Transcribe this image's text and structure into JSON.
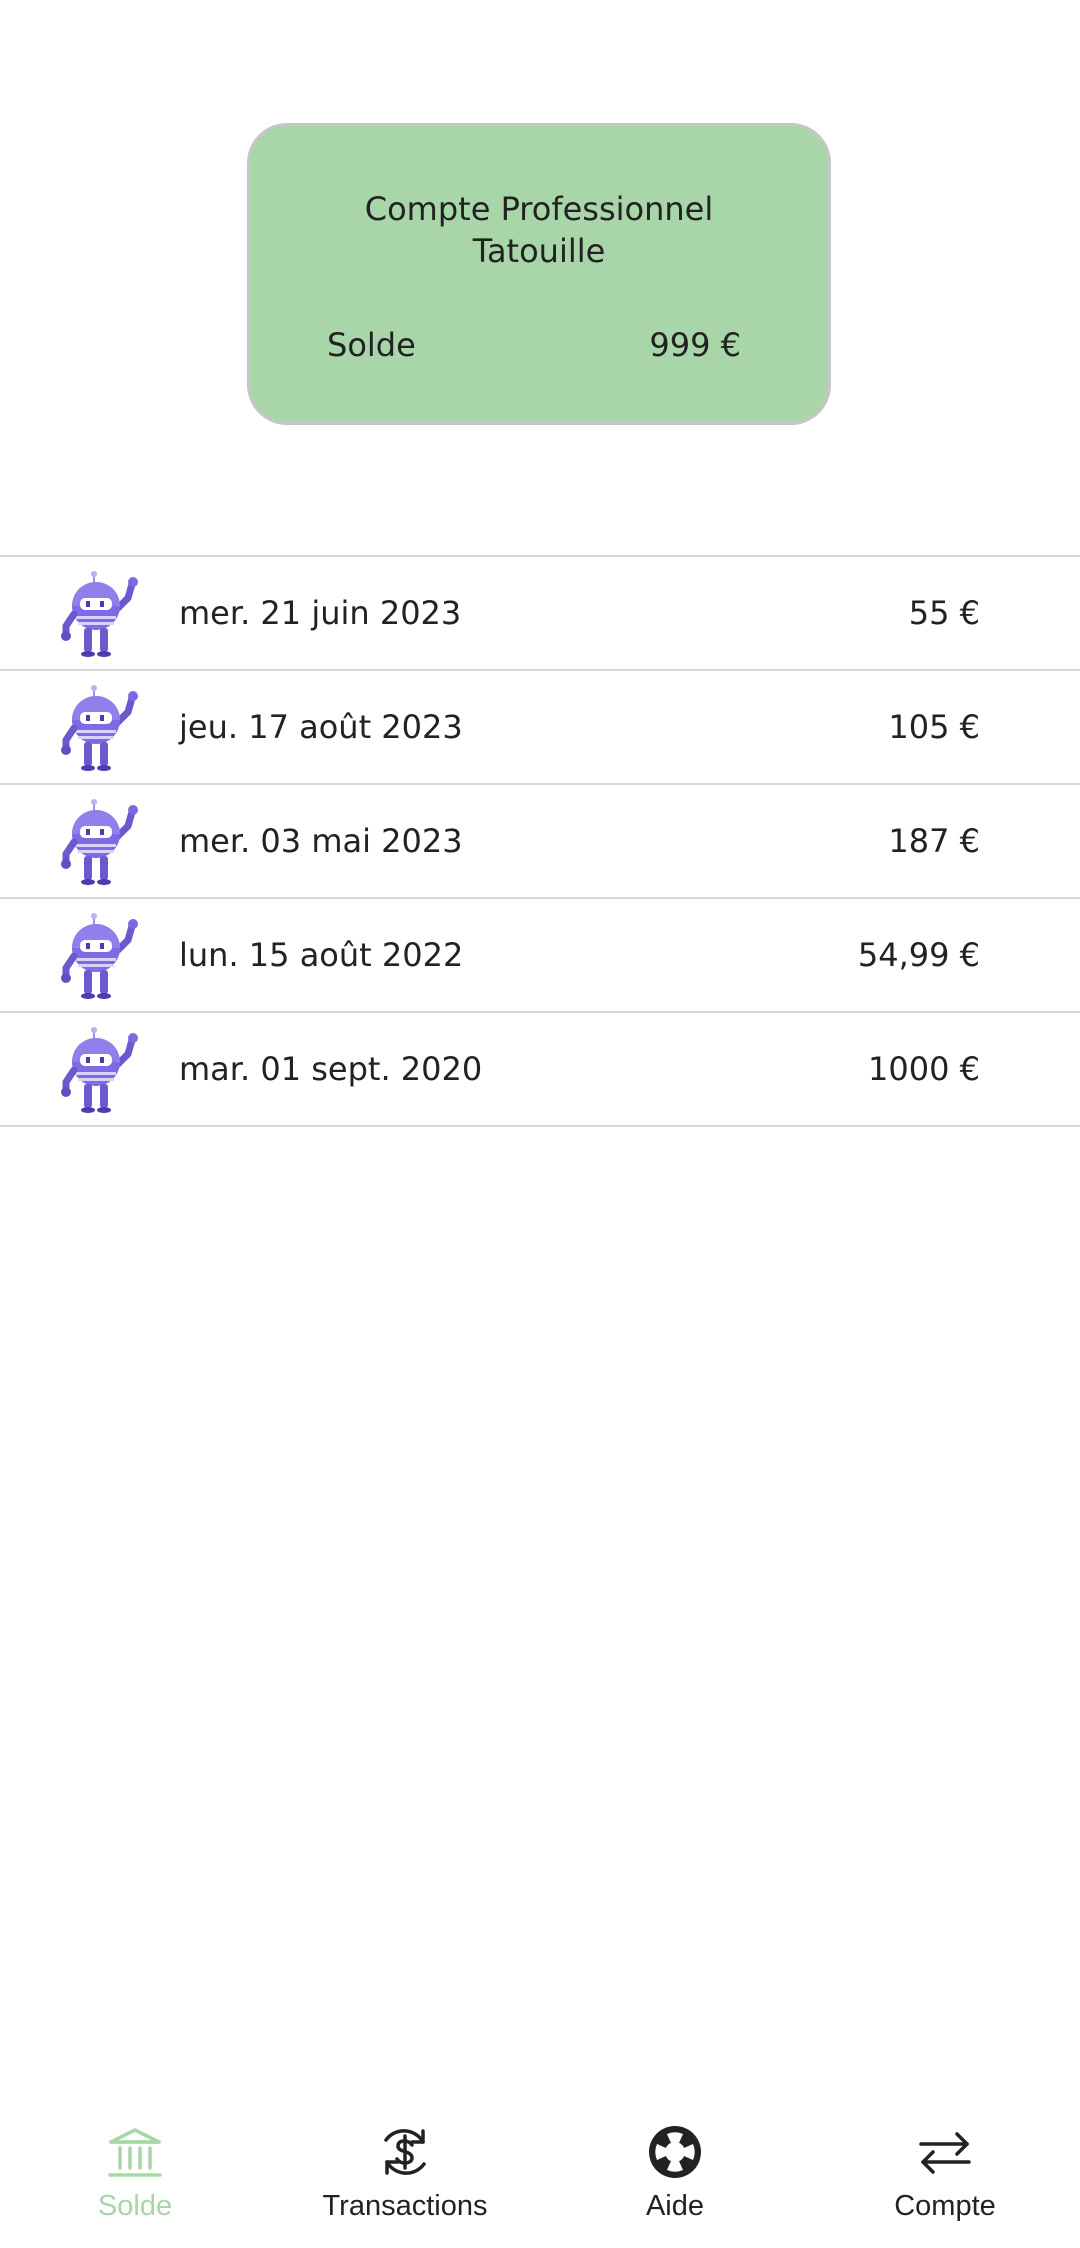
{
  "account_card": {
    "title_line1": "Compte Professionnel",
    "title_line2": "Tatouille",
    "balance_label": "Solde",
    "balance_value": "999 €",
    "background_color": "#a9d6a8"
  },
  "transactions": [
    {
      "date": "mer. 21 juin 2023",
      "amount": "55 €",
      "avatar_icon": "android-robot-icon"
    },
    {
      "date": "jeu. 17 août 2023",
      "amount": "105 €",
      "avatar_icon": "android-robot-icon"
    },
    {
      "date": "mer. 03 mai 2023",
      "amount": "187 €",
      "avatar_icon": "android-robot-icon"
    },
    {
      "date": "lun. 15 août 2022",
      "amount": "54,99 €",
      "avatar_icon": "android-robot-icon"
    },
    {
      "date": "mar. 01 sept. 2020",
      "amount": "1000 €",
      "avatar_icon": "android-robot-icon"
    }
  ],
  "bottom_nav": {
    "active_color": "#a9d6a8",
    "items": [
      {
        "label": "Solde",
        "icon": "bank-icon",
        "active": true
      },
      {
        "label": "Transactions",
        "icon": "dollar-sync-icon",
        "active": false
      },
      {
        "label": "Aide",
        "icon": "lifebuoy-icon",
        "active": false
      },
      {
        "label": "Compte",
        "icon": "swap-arrows-icon",
        "active": false
      }
    ]
  }
}
